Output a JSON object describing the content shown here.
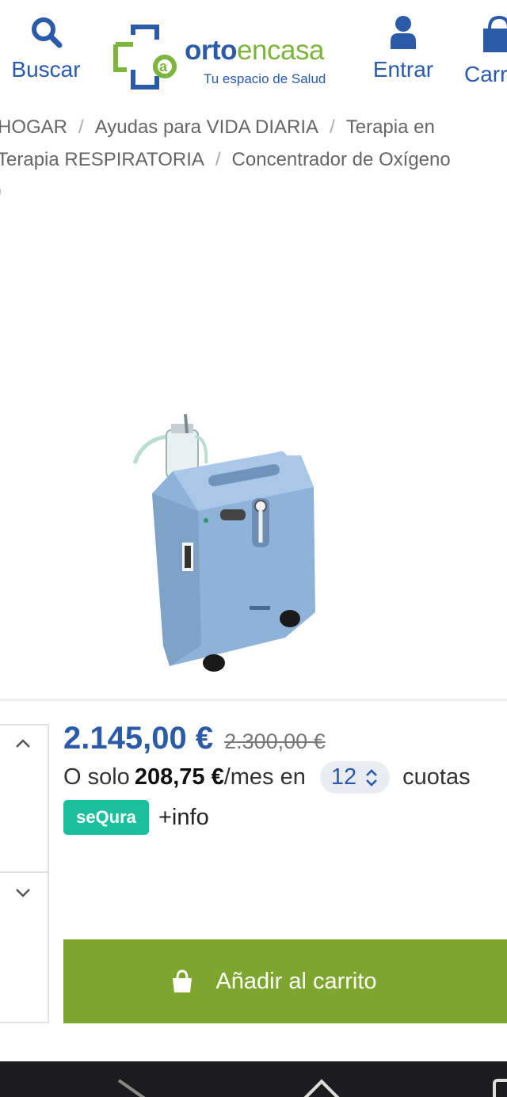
{
  "header": {
    "search_label": "Buscar",
    "login_label": "Entrar",
    "cart_label": "Carr",
    "logo": {
      "brand_bold": "orto",
      "brand_light": "encasa",
      "tagline": "Tu espacio de Salud"
    },
    "accent_color": "#2a5aa8",
    "brand_green": "#7db43c"
  },
  "breadcrumb": {
    "row1": [
      "HOGAR",
      "Ayudas para VIDA DIARIA",
      "Terapia en"
    ],
    "row2": [
      "Terapia RESPIRATORIA",
      "Concentrador de Oxígeno"
    ],
    "row3": ")"
  },
  "product": {
    "image_icon": "oxygen-concentrator-image",
    "price_current": "2.145,00 €",
    "price_original": "2.300,00 €",
    "finance_prefix": "O solo",
    "finance_amount": "208,75 €",
    "finance_middle": "/mes en",
    "installments_value": "12",
    "finance_suffix": "cuotas",
    "sequra_label": "seQura",
    "more_info": "+info",
    "add_to_cart": "Añadir al carrito"
  }
}
